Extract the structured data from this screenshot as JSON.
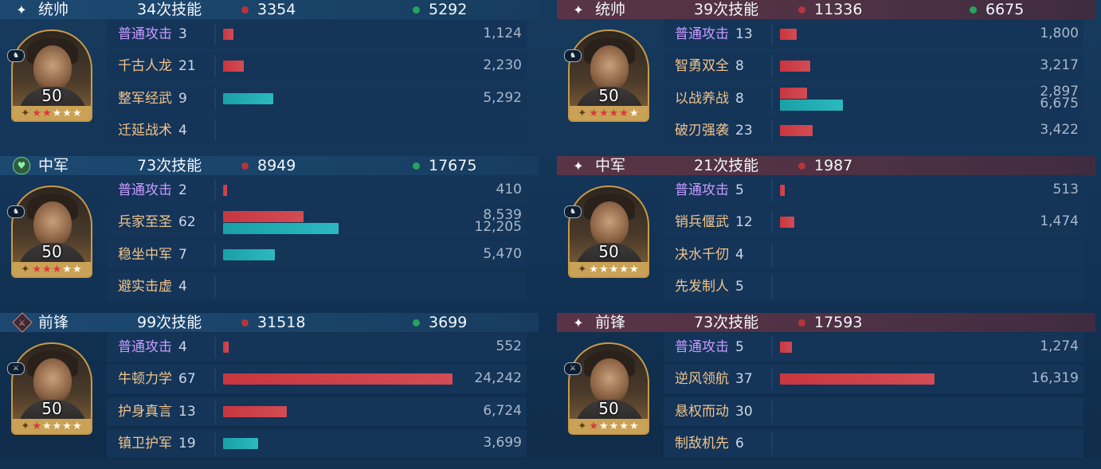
{
  "left": [
    {
      "role": "统帅",
      "role_icon": "sparkle-icon",
      "casts": "34次技能",
      "red_total": "3354",
      "green_total": "5292",
      "portrait": {
        "level": "50",
        "red_stars": 2,
        "badge_icon": "horse-icon"
      },
      "skills": [
        {
          "name": "普通攻击",
          "count": "3",
          "type": "basic",
          "red": 1124,
          "red_label": "1,124"
        },
        {
          "name": "千古人龙",
          "count": "21",
          "type": "skill",
          "red": 2230,
          "red_label": "2,230"
        },
        {
          "name": "整军经武",
          "count": "9",
          "type": "skill",
          "teal": 5292,
          "teal_label": "5,292"
        },
        {
          "name": "迁延战术",
          "count": "4",
          "type": "skill"
        }
      ]
    },
    {
      "role": "中军",
      "role_icon": "shield-icon",
      "casts": "73次技能",
      "red_total": "8949",
      "green_total": "17675",
      "portrait": {
        "level": "50",
        "red_stars": 3,
        "badge_icon": "horse-icon"
      },
      "skills": [
        {
          "name": "普通攻击",
          "count": "2",
          "type": "basic",
          "red": 410,
          "red_label": "410"
        },
        {
          "name": "兵家至圣",
          "count": "62",
          "type": "skill",
          "red": 8539,
          "red_label": "8,539",
          "teal": 12205,
          "teal_label": "12,205"
        },
        {
          "name": "稳坐中军",
          "count": "7",
          "type": "skill",
          "teal": 5470,
          "teal_label": "5,470"
        },
        {
          "name": "避实击虚",
          "count": "4",
          "type": "skill"
        }
      ]
    },
    {
      "role": "前锋",
      "role_icon": "sword-icon",
      "casts": "99次技能",
      "red_total": "31518",
      "green_total": "3699",
      "portrait": {
        "level": "50",
        "red_stars": 1,
        "badge_icon": "sword-icon"
      },
      "skills": [
        {
          "name": "普通攻击",
          "count": "4",
          "type": "basic",
          "red": 552,
          "red_label": "552"
        },
        {
          "name": "牛顿力学",
          "count": "67",
          "type": "skill",
          "red": 24242,
          "red_label": "24,242"
        },
        {
          "name": "护身真言",
          "count": "13",
          "type": "skill",
          "red": 6724,
          "red_label": "6,724"
        },
        {
          "name": "镇卫护军",
          "count": "19",
          "type": "skill",
          "teal": 3699,
          "teal_label": "3,699"
        }
      ]
    }
  ],
  "right": [
    {
      "role": "统帅",
      "role_icon": "sparkle-icon",
      "casts": "39次技能",
      "red_total": "11336",
      "green_total": "6675",
      "portrait": {
        "level": "50",
        "red_stars": 4,
        "badge_icon": "horse-icon"
      },
      "skills": [
        {
          "name": "普通攻击",
          "count": "13",
          "type": "basic",
          "red": 1800,
          "red_label": "1,800"
        },
        {
          "name": "智勇双全",
          "count": "8",
          "type": "skill",
          "red": 3217,
          "red_label": "3,217"
        },
        {
          "name": "以战养战",
          "count": "8",
          "type": "skill",
          "red": 2897,
          "red_label": "2,897",
          "teal": 6675,
          "teal_label": "6,675"
        },
        {
          "name": "破刃强袭",
          "count": "23",
          "type": "skill",
          "red": 3422,
          "red_label": "3,422"
        }
      ]
    },
    {
      "role": "中军",
      "role_icon": "sparkle-icon",
      "casts": "21次技能",
      "red_total": "1987",
      "green_total": "",
      "portrait": {
        "level": "50",
        "red_stars": 0,
        "badge_icon": "horse-icon"
      },
      "skills": [
        {
          "name": "普通攻击",
          "count": "5",
          "type": "basic",
          "red": 513,
          "red_label": "513"
        },
        {
          "name": "销兵偃武",
          "count": "12",
          "type": "skill",
          "red": 1474,
          "red_label": "1,474"
        },
        {
          "name": "决水千仞",
          "count": "4",
          "type": "skill"
        },
        {
          "name": "先发制人",
          "count": "5",
          "type": "skill"
        }
      ]
    },
    {
      "role": "前锋",
      "role_icon": "sparkle-icon",
      "casts": "73次技能",
      "red_total": "17593",
      "green_total": "",
      "portrait": {
        "level": "50",
        "red_stars": 1,
        "badge_icon": "sword-icon"
      },
      "skills": [
        {
          "name": "普通攻击",
          "count": "5",
          "type": "basic",
          "red": 1274,
          "red_label": "1,274"
        },
        {
          "name": "逆风领航",
          "count": "37",
          "type": "skill",
          "red": 16319,
          "red_label": "16,319"
        },
        {
          "name": "悬权而动",
          "count": "30",
          "type": "skill"
        },
        {
          "name": "制敌机先",
          "count": "6",
          "type": "skill"
        }
      ]
    }
  ],
  "bar_scale_max": 24242,
  "colors": {
    "damage": "#c8363f",
    "heal": "#1aa0a7",
    "basic_attack": "#c89cff",
    "skill_name": "#f1c48a"
  }
}
